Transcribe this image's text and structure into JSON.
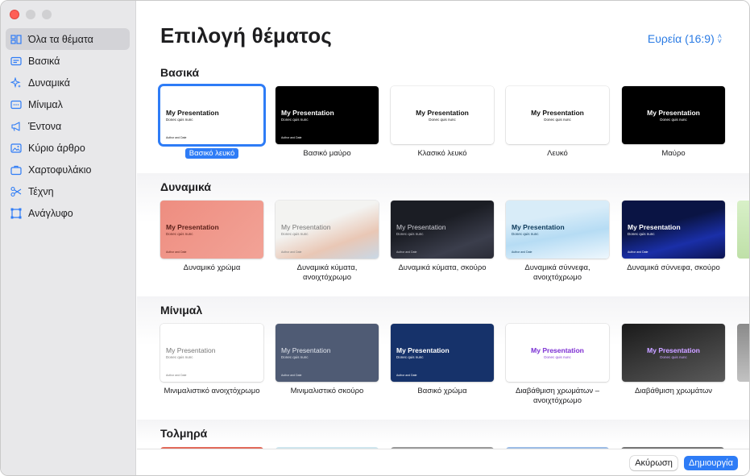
{
  "sidebar": {
    "items": [
      {
        "label": "Όλα τα θέματα",
        "icon": "all-themes-icon",
        "active": true
      },
      {
        "label": "Βασικά",
        "icon": "basic-icon"
      },
      {
        "label": "Δυναμικά",
        "icon": "sparkles-icon"
      },
      {
        "label": "Μίνιμαλ",
        "icon": "minimal-icon"
      },
      {
        "label": "Έντονα",
        "icon": "megaphone-icon"
      },
      {
        "label": "Κύριο άρθρο",
        "icon": "photo-icon"
      },
      {
        "label": "Χαρτοφυλάκιο",
        "icon": "briefcase-icon"
      },
      {
        "label": "Τέχνη",
        "icon": "scissors-icon"
      },
      {
        "label": "Ανάγλυφο",
        "icon": "frame-icon"
      }
    ]
  },
  "header": {
    "title": "Επιλογή θέματος",
    "aspect_label": "Ευρεία (16:9)"
  },
  "thumb_text": {
    "title": "My Presentation",
    "subtitle": "Donec quis nunc",
    "author": "Author and Date"
  },
  "sections": [
    {
      "title": "Βασικά",
      "themes": [
        {
          "caption": "Βασικό λευκό",
          "bg": "#ffffff",
          "fg": "#111111",
          "selected": true
        },
        {
          "caption": "Βασικό μαύρο",
          "bg": "#000000",
          "fg": "#ffffff"
        },
        {
          "caption": "Κλασικό λευκό",
          "bg": "#ffffff",
          "fg": "#111111",
          "center": true
        },
        {
          "caption": "Λευκό",
          "bg": "#ffffff",
          "fg": "#111111",
          "center": true
        },
        {
          "caption": "Μαύρο",
          "bg": "#000000",
          "fg": "#ffffff",
          "center": true
        }
      ]
    },
    {
      "title": "Δυναμικά",
      "themes": [
        {
          "caption": "Δυναμικό χρώμα",
          "bg": "linear-gradient(135deg,#ee8d80,#f2a397)",
          "fg": "#5a1f18"
        },
        {
          "caption": "Δυναμικά κύματα, ανοιχτόχρωμο",
          "bg": "linear-gradient(160deg,#f3f3f1 40%,#e9c7b5 70%,#c9d8e6)",
          "fg": "#777777",
          "light": true
        },
        {
          "caption": "Δυναμικά κύματα, σκούρο",
          "bg": "linear-gradient(160deg,#1b1d24 40%,#3b3e4c 75%,#2a2c36)",
          "fg": "#cfcfd6",
          "light": true
        },
        {
          "caption": "Δυναμικά σύννεφα, ανοιχτόχρωμο",
          "bg": "linear-gradient(170deg,#d8ecf8 30%,#b6dcf4 60%,#eef7fd)",
          "fg": "#0e3a5a"
        },
        {
          "caption": "Δυναμικά σύννεφα, σκούρο",
          "bg": "linear-gradient(165deg,#0a1444 40%,#1a2fa8 70%,#0c1450)",
          "fg": "#ffffff"
        }
      ],
      "peek": "linear-gradient(#d8f0c8,#bfe0a8)"
    },
    {
      "title": "Μίνιμαλ",
      "themes": [
        {
          "caption": "Μινιμαλιστικό ανοιχτόχρωμο",
          "bg": "#ffffff",
          "fg": "#777777",
          "light": true
        },
        {
          "caption": "Μινιμαλιστικό σκούρο",
          "bg": "#4f5b74",
          "fg": "#e2e6ee",
          "light": true
        },
        {
          "caption": "Βασικό χρώμα",
          "bg": "#16326a",
          "fg": "#ffffff"
        },
        {
          "caption": "Διαβάθμιση χρωμάτων – ανοιχτόχρωμο",
          "bg": "#ffffff",
          "fg": "#8a43d6",
          "center": true,
          "grad": true
        },
        {
          "caption": "Διαβάθμιση χρωμάτων",
          "bg": "linear-gradient(160deg,#1a1a1a,#5a5a5a)",
          "fg": "#c9a2ff",
          "center": true,
          "grad": true
        }
      ],
      "peek": "linear-gradient(#8a8a8a,#c2c2c2)"
    },
    {
      "title": "Τολμηρά",
      "themes": []
    }
  ],
  "buttons": {
    "cancel": "Ακύρωση",
    "create": "Δημιουργία"
  },
  "colors": {
    "accent": "#2e7cf6",
    "link": "#2a7be4"
  }
}
